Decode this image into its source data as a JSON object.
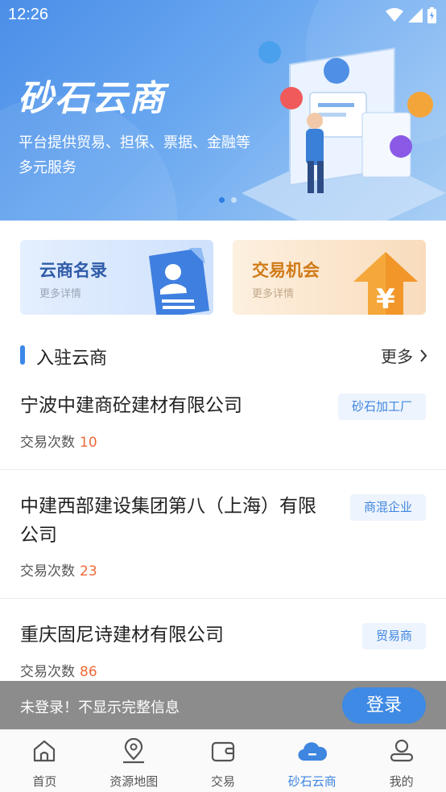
{
  "status": {
    "time": "12:26"
  },
  "banner": {
    "title": "砂石云商",
    "subtitle": "平台提供贸易、担保、票据、金融等多元服务",
    "slides_total": 2,
    "slide_active": 1
  },
  "cards": [
    {
      "title": "云商名录",
      "sub": "更多详情"
    },
    {
      "title": "交易机会",
      "sub": "更多详情"
    }
  ],
  "section": {
    "title": "入驻云商",
    "more": "更多"
  },
  "companies": [
    {
      "name": "宁波中建商砼建材有限公司",
      "count_label": "交易次数",
      "count": "10",
      "tag": "砂石加工厂"
    },
    {
      "name": "中建西部建设集团第八（上海）有限公司",
      "count_label": "交易次数",
      "count": "23",
      "tag": "商混企业"
    },
    {
      "name": "重庆固尼诗建材有限公司",
      "count_label": "交易次数",
      "count": "86",
      "tag": "贸易商"
    }
  ],
  "login": {
    "message": "未登录！不显示完整信息",
    "button": "登录"
  },
  "tabbar": [
    {
      "label": "首页",
      "icon": "home-icon"
    },
    {
      "label": "资源地图",
      "icon": "map-pin-icon"
    },
    {
      "label": "交易",
      "icon": "wallet-icon"
    },
    {
      "label": "砂石云商",
      "icon": "cloud-icon",
      "active": true
    },
    {
      "label": "我的",
      "icon": "user-icon"
    }
  ],
  "colors": {
    "accent": "#3e86e0",
    "count": "#ee6a3a",
    "orange": "#d07a18"
  }
}
